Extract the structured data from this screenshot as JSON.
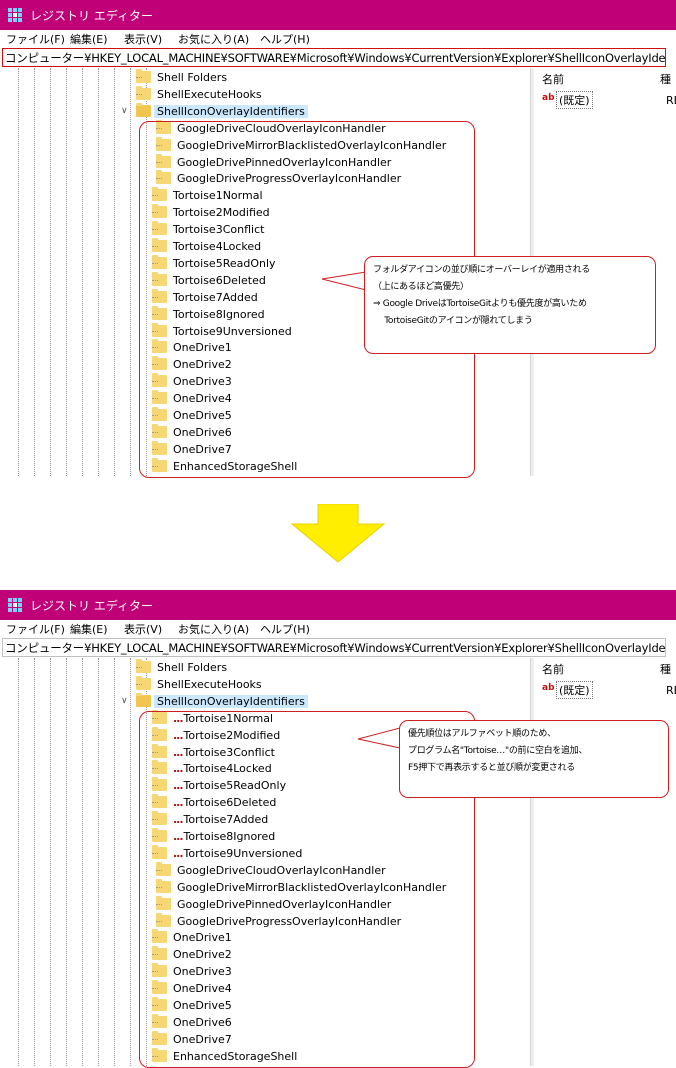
{
  "window": {
    "title": "レジストリ エディター",
    "menu": [
      "ファイル(F)",
      "編集(E)",
      "表示(V)",
      "お気に入り(A)",
      "ヘルプ(H)"
    ],
    "address": "コンピューター¥HKEY_LOCAL_MACHINE¥SOFTWARE¥Microsoft¥Windows¥CurrentVersion¥Explorer¥ShellIconOverlayIdentifiers",
    "values_pane": {
      "name_header": "名前",
      "type_header": "種",
      "default_label": "(既定)",
      "ab_icon": "ab",
      "truncated_data": "RE"
    }
  },
  "colors": {
    "titlebar": "#bf0077",
    "highlight_box": "#cc2020",
    "arrow": "#ffee00",
    "selection": "#cce8ff"
  },
  "before": {
    "parent_nodes": [
      "Shell Folders",
      "ShellExecuteHooks"
    ],
    "selected_key": "ShellIconOverlayIdentifiers",
    "children": [
      " GoogleDriveCloudOverlayIconHandler",
      " GoogleDriveMirrorBlacklistedOverlayIconHandler",
      " GoogleDrivePinnedOverlayIconHandler",
      " GoogleDriveProgressOverlayIconHandler",
      "Tortoise1Normal",
      "Tortoise2Modified",
      "Tortoise3Conflict",
      "Tortoise4Locked",
      "Tortoise5ReadOnly",
      "Tortoise6Deleted",
      "Tortoise7Added",
      "Tortoise8Ignored",
      "Tortoise9Unversioned",
      "OneDrive1",
      "OneDrive2",
      "OneDrive3",
      "OneDrive4",
      "OneDrive5",
      "OneDrive6",
      "OneDrive7",
      "EnhancedStorageShell"
    ],
    "callout": [
      "フォルダアイコンの並び順にオーバーレイが適用される",
      "（上にあるほど高優先）",
      "⇒ Google DriveはTortoiseGitよりも優先度が高いため",
      "　 TortoiseGitのアイコンが隠れてしまう"
    ]
  },
  "after": {
    "parent_nodes": [
      "Shell Folders",
      "ShellExecuteHooks"
    ],
    "selected_key": "ShellIconOverlayIdentifiers",
    "marked_prefix": "...",
    "marked_children": [
      "Tortoise1Normal",
      "Tortoise2Modified",
      "Tortoise3Conflict",
      "Tortoise4Locked",
      "Tortoise5ReadOnly",
      "Tortoise6Deleted",
      "Tortoise7Added",
      "Tortoise8Ignored",
      "Tortoise9Unversioned"
    ],
    "children": [
      " GoogleDriveCloudOverlayIconHandler",
      " GoogleDriveMirrorBlacklistedOverlayIconHandler",
      " GoogleDrivePinnedOverlayIconHandler",
      " GoogleDriveProgressOverlayIconHandler",
      "OneDrive1",
      "OneDrive2",
      "OneDrive3",
      "OneDrive4",
      "OneDrive5",
      "OneDrive6",
      "OneDrive7",
      "EnhancedStorageShell"
    ],
    "callout": [
      "優先順位はアルファベット順のため、",
      "プログラム名\"Tortoise…\"の前に空白を追加、",
      "F5押下で再表示すると並び順が変更される"
    ]
  }
}
